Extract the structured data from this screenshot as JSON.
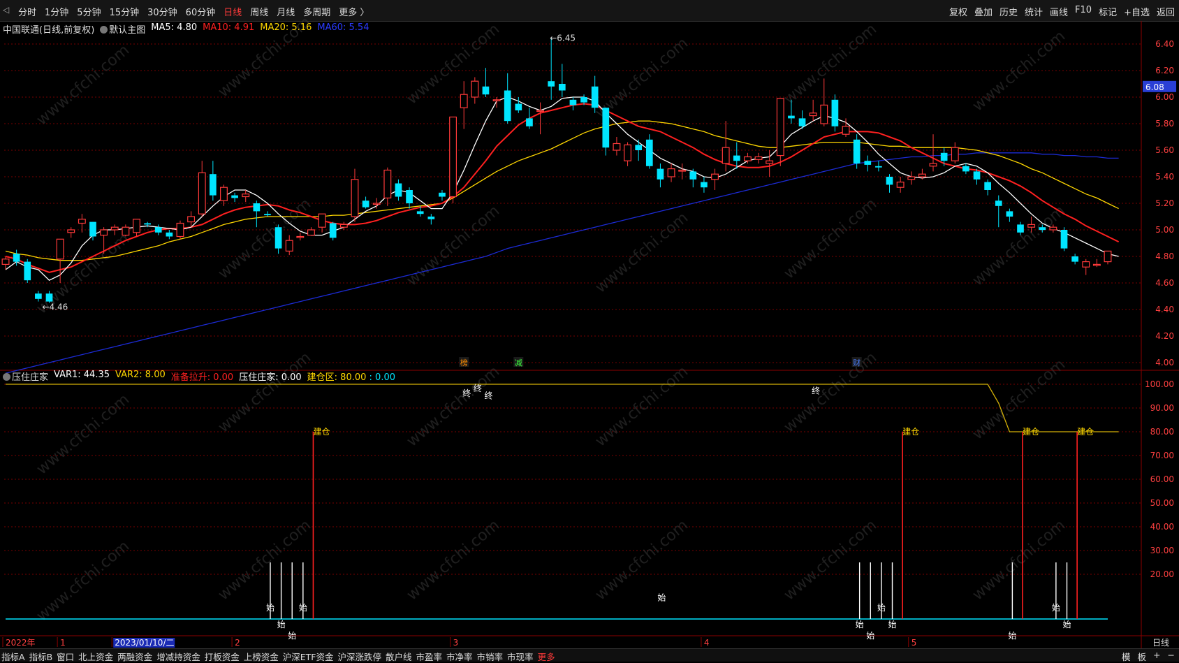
{
  "toolbar": {
    "periods": [
      "分时",
      "1分钟",
      "5分钟",
      "15分钟",
      "30分钟",
      "60分钟",
      "日线",
      "周线",
      "月线",
      "多周期",
      "更多 〉"
    ],
    "active_period": "日线",
    "right_buttons": [
      "复权",
      "叠加",
      "历史",
      "统计",
      "画线",
      "F10",
      "标记",
      "+自选",
      "返回"
    ]
  },
  "main_legend": {
    "title": "中国联通(日线,前复权)",
    "template": "默认主图",
    "ma5": "MA5: 4.80",
    "ma10": "MA10: 4.91",
    "ma20": "MA20: 5.16",
    "ma60": "MA60: 5.54"
  },
  "indicator_legend": {
    "name": "压住庄家",
    "var1": "VAR1: 44.35",
    "var2": "VAR2: 8.00",
    "rise": "准备拉升: 0.00",
    "press": "压住庄家: 0.00",
    "build_label": "建仓区: 80.00",
    "build_extra": ": 0.00"
  },
  "colors": {
    "up": "#ff3a3a",
    "down": "#00e5ff",
    "ma5": "#ffffff",
    "ma10": "#ff2020",
    "ma20": "#ffd700",
    "ma60": "#1c2bd6",
    "grid": "#7a0000",
    "build_line": "#d4b106",
    "baseline": "#00e5ff"
  },
  "chart_data": {
    "type": "candlestick",
    "price_axis": {
      "min": 4.0,
      "max": 6.4,
      "ticks": [
        "6.40",
        "6.20",
        "6.00",
        "5.80",
        "5.60",
        "5.40",
        "5.20",
        "5.00",
        "4.80",
        "4.60",
        "4.40",
        "4.20",
        "4.00"
      ]
    },
    "current_price": "6.08",
    "annotations": {
      "high": "6.45",
      "low": "4.46",
      "markers": [
        "榜",
        "减",
        "财"
      ]
    },
    "candles": [
      [
        4.74,
        4.78,
        4.7,
        4.8
      ],
      [
        4.82,
        4.76,
        4.73,
        4.85
      ],
      [
        4.76,
        4.62,
        4.6,
        4.78
      ],
      [
        4.52,
        4.48,
        4.46,
        4.54
      ],
      [
        4.52,
        4.46,
        4.45,
        4.54
      ],
      [
        4.78,
        4.93,
        4.6,
        4.93
      ],
      [
        4.98,
        5.0,
        4.94,
        5.02
      ],
      [
        5.05,
        5.08,
        4.98,
        5.12
      ],
      [
        5.06,
        4.95,
        4.92,
        5.06
      ],
      [
        4.96,
        5.0,
        4.82,
        5.02
      ],
      [
        5.0,
        5.02,
        4.96,
        5.04
      ],
      [
        4.96,
        5.02,
        4.95,
        5.04
      ],
      [
        4.98,
        5.08,
        4.95,
        5.08
      ],
      [
        5.05,
        5.04,
        5.02,
        5.06
      ],
      [
        5.02,
        4.98,
        4.96,
        5.04
      ],
      [
        4.98,
        4.95,
        4.93,
        5.0
      ],
      [
        4.95,
        5.05,
        4.93,
        5.07
      ],
      [
        5.06,
        5.1,
        5.02,
        5.14
      ],
      [
        5.12,
        5.43,
        5.1,
        5.52
      ],
      [
        5.42,
        5.26,
        5.22,
        5.52
      ],
      [
        5.22,
        5.32,
        5.18,
        5.34
      ],
      [
        5.26,
        5.24,
        5.21,
        5.28
      ],
      [
        5.25,
        5.27,
        5.21,
        5.3
      ],
      [
        5.2,
        5.14,
        5.02,
        5.22
      ],
      [
        5.12,
        5.11,
        5.1,
        5.14
      ],
      [
        5.02,
        4.86,
        4.82,
        5.04
      ],
      [
        4.84,
        4.92,
        4.81,
        4.96
      ],
      [
        4.95,
        4.95,
        4.92,
        4.98
      ],
      [
        4.96,
        5.0,
        4.96,
        5.02
      ],
      [
        5.02,
        5.12,
        4.98,
        5.12
      ],
      [
        5.05,
        4.94,
        4.92,
        5.06
      ],
      [
        5.02,
        5.04,
        5.0,
        5.06
      ],
      [
        5.1,
        5.38,
        5.06,
        5.46
      ],
      [
        5.22,
        5.17,
        5.16,
        5.25
      ],
      [
        5.2,
        5.2,
        5.16,
        5.24
      ],
      [
        5.24,
        5.45,
        5.18,
        5.47
      ],
      [
        5.35,
        5.25,
        5.22,
        5.38
      ],
      [
        5.3,
        5.2,
        5.16,
        5.32
      ],
      [
        5.14,
        5.12,
        5.1,
        5.18
      ],
      [
        5.1,
        5.08,
        5.04,
        5.12
      ],
      [
        5.28,
        5.25,
        5.22,
        5.3
      ],
      [
        5.25,
        5.85,
        5.2,
        5.82
      ],
      [
        5.92,
        6.02,
        5.76,
        6.12
      ],
      [
        6.0,
        6.12,
        5.95,
        6.15
      ],
      [
        6.08,
        6.02,
        6.0,
        6.22
      ],
      [
        5.98,
        5.98,
        5.92,
        6.0
      ],
      [
        6.05,
        5.82,
        5.8,
        6.18
      ],
      [
        5.95,
        5.9,
        5.88,
        6.0
      ],
      [
        5.84,
        5.78,
        5.76,
        5.92
      ],
      [
        5.9,
        5.9,
        5.72,
        5.96
      ],
      [
        6.12,
        6.08,
        5.98,
        6.45
      ],
      [
        6.1,
        6.05,
        6.0,
        6.25
      ],
      [
        5.98,
        5.94,
        5.9,
        6.0
      ],
      [
        6.0,
        5.96,
        5.94,
        6.02
      ],
      [
        6.08,
        5.92,
        5.88,
        6.16
      ],
      [
        5.92,
        5.62,
        5.56,
        5.92
      ],
      [
        5.6,
        5.65,
        5.56,
        5.7
      ],
      [
        5.52,
        5.64,
        5.48,
        5.66
      ],
      [
        5.64,
        5.6,
        5.52,
        5.68
      ],
      [
        5.68,
        5.48,
        5.46,
        5.72
      ],
      [
        5.46,
        5.38,
        5.32,
        5.5
      ],
      [
        5.4,
        5.46,
        5.36,
        5.5
      ],
      [
        5.45,
        5.45,
        5.38,
        5.5
      ],
      [
        5.44,
        5.38,
        5.32,
        5.46
      ],
      [
        5.36,
        5.32,
        5.28,
        5.4
      ],
      [
        5.38,
        5.42,
        5.3,
        5.46
      ],
      [
        5.5,
        5.62,
        5.44,
        5.82
      ],
      [
        5.56,
        5.52,
        5.46,
        5.66
      ],
      [
        5.52,
        5.55,
        5.5,
        5.58
      ],
      [
        5.53,
        5.55,
        5.5,
        5.58
      ],
      [
        5.5,
        5.52,
        5.4,
        5.6
      ],
      [
        5.56,
        5.99,
        5.48,
        5.99
      ],
      [
        5.86,
        5.84,
        5.8,
        5.98
      ],
      [
        5.84,
        5.78,
        5.76,
        5.9
      ],
      [
        5.86,
        5.88,
        5.82,
        5.98
      ],
      [
        5.8,
        5.94,
        5.78,
        6.14
      ],
      [
        5.98,
        5.78,
        5.74,
        6.02
      ],
      [
        5.72,
        5.78,
        5.7,
        5.84
      ],
      [
        5.68,
        5.5,
        5.46,
        5.72
      ],
      [
        5.52,
        5.49,
        5.44,
        5.56
      ],
      [
        5.48,
        5.47,
        5.44,
        5.52
      ],
      [
        5.4,
        5.34,
        5.28,
        5.42
      ],
      [
        5.32,
        5.36,
        5.28,
        5.4
      ],
      [
        5.38,
        5.4,
        5.34,
        5.44
      ],
      [
        5.4,
        5.42,
        5.38,
        5.46
      ],
      [
        5.48,
        5.5,
        5.44,
        5.72
      ],
      [
        5.58,
        5.52,
        5.48,
        5.62
      ],
      [
        5.52,
        5.62,
        5.5,
        5.66
      ],
      [
        5.48,
        5.44,
        5.42,
        5.5
      ],
      [
        5.44,
        5.38,
        5.34,
        5.46
      ],
      [
        5.36,
        5.3,
        5.26,
        5.38
      ],
      [
        5.22,
        5.18,
        5.02,
        5.26
      ],
      [
        5.14,
        5.1,
        5.06,
        5.16
      ],
      [
        5.04,
        4.98,
        4.96,
        5.06
      ],
      [
        5.02,
        5.04,
        4.98,
        5.1
      ],
      [
        5.02,
        5.0,
        4.98,
        5.04
      ],
      [
        5.0,
        5.02,
        4.98,
        5.04
      ],
      [
        5.0,
        4.86,
        4.84,
        5.02
      ],
      [
        4.8,
        4.76,
        4.74,
        4.82
      ],
      [
        4.72,
        4.76,
        4.66,
        4.78
      ],
      [
        4.74,
        4.74,
        4.72,
        4.78
      ],
      [
        4.76,
        4.84,
        4.74,
        4.84
      ]
    ],
    "ma5": [
      4.7,
      4.76,
      4.72,
      4.7,
      4.62,
      4.66,
      4.75,
      4.88,
      4.96,
      5.0,
      5.0,
      5.01,
      5.02,
      5.03,
      5.02,
      5.01,
      5.0,
      5.02,
      5.1,
      5.18,
      5.25,
      5.3,
      5.3,
      5.26,
      5.2,
      5.12,
      5.05,
      4.99,
      4.96,
      4.96,
      4.99,
      5.02,
      5.08,
      5.14,
      5.18,
      5.26,
      5.3,
      5.28,
      5.22,
      5.16,
      5.16,
      5.28,
      5.45,
      5.64,
      5.82,
      5.97,
      6.0,
      5.97,
      5.93,
      5.9,
      5.93,
      5.99,
      6.0,
      6.0,
      5.97,
      5.88,
      5.8,
      5.72,
      5.66,
      5.6,
      5.54,
      5.5,
      5.46,
      5.44,
      5.4,
      5.39,
      5.42,
      5.47,
      5.52,
      5.54,
      5.55,
      5.63,
      5.72,
      5.77,
      5.82,
      5.86,
      5.84,
      5.81,
      5.74,
      5.66,
      5.57,
      5.5,
      5.43,
      5.4,
      5.39,
      5.4,
      5.43,
      5.48,
      5.5,
      5.48,
      5.43,
      5.35,
      5.28,
      5.2,
      5.12,
      5.05,
      5.01,
      4.98,
      4.94,
      4.9,
      4.86,
      4.82,
      4.8
    ],
    "ma10": [
      4.8,
      4.78,
      4.74,
      4.71,
      4.68,
      4.7,
      4.72,
      4.76,
      4.8,
      4.84,
      4.88,
      4.92,
      4.95,
      4.98,
      5.0,
      5.01,
      5.01,
      5.02,
      5.04,
      5.08,
      5.12,
      5.15,
      5.17,
      5.18,
      5.19,
      5.18,
      5.15,
      5.13,
      5.1,
      5.07,
      5.05,
      5.04,
      5.04,
      5.05,
      5.07,
      5.1,
      5.13,
      5.15,
      5.17,
      5.18,
      5.2,
      5.25,
      5.32,
      5.42,
      5.52,
      5.63,
      5.71,
      5.79,
      5.84,
      5.88,
      5.9,
      5.92,
      5.94,
      5.95,
      5.94,
      5.9,
      5.86,
      5.82,
      5.78,
      5.76,
      5.74,
      5.7,
      5.66,
      5.62,
      5.57,
      5.53,
      5.5,
      5.48,
      5.47,
      5.47,
      5.48,
      5.51,
      5.55,
      5.6,
      5.65,
      5.7,
      5.72,
      5.74,
      5.74,
      5.74,
      5.73,
      5.7,
      5.67,
      5.62,
      5.58,
      5.54,
      5.5,
      5.48,
      5.46,
      5.45,
      5.43,
      5.4,
      5.37,
      5.33,
      5.28,
      5.22,
      5.17,
      5.12,
      5.08,
      5.03,
      4.99,
      4.95,
      4.91
    ],
    "ma20": [
      4.84,
      4.82,
      4.81,
      4.79,
      4.78,
      4.77,
      4.77,
      4.77,
      4.78,
      4.79,
      4.8,
      4.82,
      4.84,
      4.86,
      4.88,
      4.91,
      4.93,
      4.95,
      4.98,
      5.01,
      5.04,
      5.06,
      5.08,
      5.09,
      5.1,
      5.1,
      5.1,
      5.1,
      5.1,
      5.1,
      5.11,
      5.11,
      5.12,
      5.13,
      5.14,
      5.15,
      5.16,
      5.17,
      5.18,
      5.19,
      5.2,
      5.24,
      5.29,
      5.34,
      5.39,
      5.44,
      5.48,
      5.52,
      5.55,
      5.58,
      5.61,
      5.65,
      5.69,
      5.73,
      5.76,
      5.78,
      5.8,
      5.81,
      5.82,
      5.82,
      5.81,
      5.8,
      5.78,
      5.76,
      5.74,
      5.71,
      5.69,
      5.67,
      5.65,
      5.63,
      5.62,
      5.62,
      5.63,
      5.64,
      5.65,
      5.66,
      5.66,
      5.66,
      5.66,
      5.65,
      5.64,
      5.63,
      5.63,
      5.62,
      5.62,
      5.62,
      5.62,
      5.62,
      5.61,
      5.6,
      5.58,
      5.56,
      5.53,
      5.5,
      5.46,
      5.43,
      5.39,
      5.35,
      5.31,
      5.27,
      5.24,
      5.2,
      5.16
    ],
    "ma60": [
      3.92,
      3.94,
      3.96,
      3.98,
      4.0,
      4.02,
      4.04,
      4.06,
      4.08,
      4.1,
      4.12,
      4.14,
      4.16,
      4.18,
      4.2,
      4.22,
      4.24,
      4.26,
      4.28,
      4.3,
      4.32,
      4.34,
      4.36,
      4.38,
      4.4,
      4.42,
      4.44,
      4.46,
      4.48,
      4.5,
      4.52,
      4.54,
      4.56,
      4.58,
      4.6,
      4.62,
      4.64,
      4.66,
      4.68,
      4.7,
      4.72,
      4.74,
      4.76,
      4.78,
      4.8,
      4.83,
      4.86,
      4.88,
      4.9,
      4.92,
      4.94,
      4.96,
      4.98,
      5.0,
      5.02,
      5.04,
      5.06,
      5.08,
      5.1,
      5.12,
      5.14,
      5.16,
      5.18,
      5.2,
      5.22,
      5.24,
      5.26,
      5.28,
      5.3,
      5.32,
      5.34,
      5.36,
      5.38,
      5.4,
      5.42,
      5.44,
      5.46,
      5.48,
      5.5,
      5.51,
      5.52,
      5.53,
      5.54,
      5.55,
      5.55,
      5.56,
      5.56,
      5.57,
      5.57,
      5.58,
      5.58,
      5.58,
      5.58,
      5.58,
      5.58,
      5.57,
      5.57,
      5.56,
      5.56,
      5.55,
      5.55,
      5.54,
      5.54
    ],
    "indicator_axis": {
      "min": 0,
      "max": 100,
      "ticks": [
        "100.00",
        "90.00",
        "80.00",
        "70.00",
        "60.00",
        "50.00",
        "40.00",
        "30.00",
        "20.00"
      ]
    },
    "build_zone": [
      100,
      100,
      100,
      100,
      100,
      100,
      100,
      100,
      100,
      100,
      100,
      100,
      100,
      100,
      100,
      100,
      100,
      100,
      100,
      100,
      100,
      100,
      100,
      100,
      100,
      100,
      100,
      100,
      100,
      100,
      100,
      100,
      100,
      100,
      100,
      100,
      100,
      100,
      100,
      100,
      100,
      100,
      100,
      100,
      100,
      100,
      100,
      100,
      100,
      100,
      100,
      100,
      100,
      100,
      100,
      100,
      100,
      100,
      100,
      100,
      100,
      100,
      100,
      100,
      100,
      100,
      100,
      100,
      100,
      100,
      100,
      100,
      100,
      100,
      100,
      100,
      100,
      100,
      100,
      100,
      100,
      100,
      100,
      100,
      100,
      100,
      100,
      100,
      100,
      100,
      100,
      92,
      80,
      80,
      80,
      80,
      80,
      80,
      80,
      80,
      80,
      80,
      80
    ],
    "build_bars": [
      {
        "index": 28,
        "value": 80,
        "label": "建仓"
      },
      {
        "index": 82,
        "value": 80,
        "label": "建仓"
      },
      {
        "index": 93,
        "value": 80,
        "label": "建仓"
      },
      {
        "index": 98,
        "value": 80,
        "label": "建仓"
      }
    ],
    "start_signals": [
      24,
      25,
      26,
      27,
      78,
      79,
      80,
      81,
      92,
      96,
      97
    ],
    "start_label": "始",
    "end_signals": [
      42,
      43,
      44,
      74
    ],
    "end_label": "终",
    "x_axis": {
      "labels": [
        {
          "index": 0,
          "text": "2022年"
        },
        {
          "index": 5,
          "text": "1"
        },
        {
          "index": 10,
          "text": "2023/01/10/二"
        },
        {
          "index": 21,
          "text": "2"
        },
        {
          "index": 41,
          "text": "3"
        },
        {
          "index": 64,
          "text": "4"
        },
        {
          "index": 83,
          "text": "5"
        }
      ]
    }
  },
  "watermark": "www.cfchi.com",
  "bottom_tabs": [
    "指标A",
    "指标B",
    "窗口",
    "北上资金",
    "两融资金",
    "增减持资金",
    "打板资金",
    "上榜资金",
    "沪深ETF资金",
    "沪深涨跌停",
    "散户线",
    "市盈率",
    "市净率",
    "市销率",
    "市现率",
    "更多"
  ],
  "bottom_right": [
    "模",
    "板",
    "+",
    "−"
  ],
  "period_label": "日线"
}
